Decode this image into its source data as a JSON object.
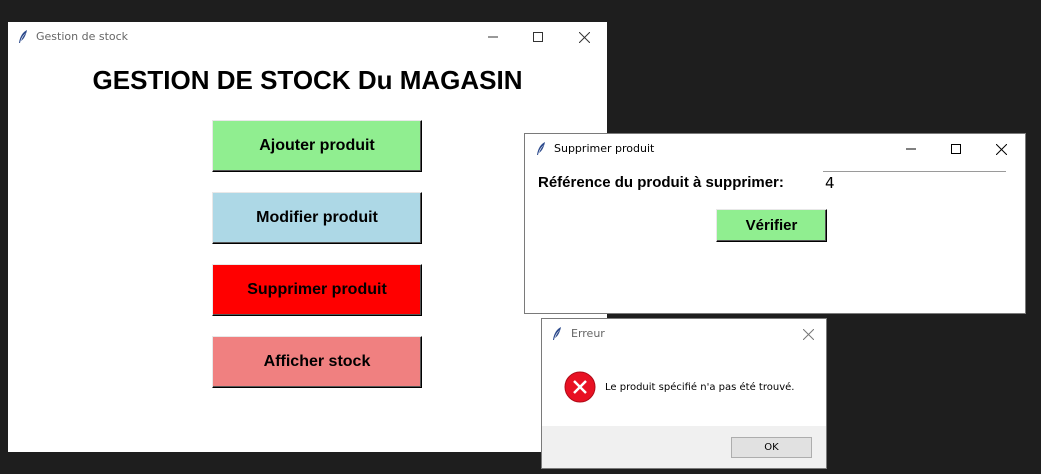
{
  "main_window": {
    "title": "Gestion de stock",
    "heading": "GESTION DE STOCK Du MAGASIN",
    "buttons": {
      "ajouter": "Ajouter produit",
      "modifier": "Modifier produit",
      "supprimer": "Supprimer produit",
      "afficher": "Afficher stock"
    },
    "button_colors": {
      "ajouter": "#90ee90",
      "modifier": "#add8e6",
      "supprimer": "#ff0000",
      "afficher": "#f08080"
    }
  },
  "delete_window": {
    "title": "Supprimer produit",
    "label": "Référence du produit à supprimer:",
    "input_value": "4",
    "verify_label": "Vérifier"
  },
  "error_dialog": {
    "title": "Erreur",
    "message": "Le produit spécifié n'a pas été trouvé.",
    "ok_label": "OK"
  },
  "icons": {
    "app_icon": "feather-icon",
    "minimize": "minimize-icon",
    "maximize": "maximize-icon",
    "close": "close-icon",
    "error": "error-x-icon"
  }
}
